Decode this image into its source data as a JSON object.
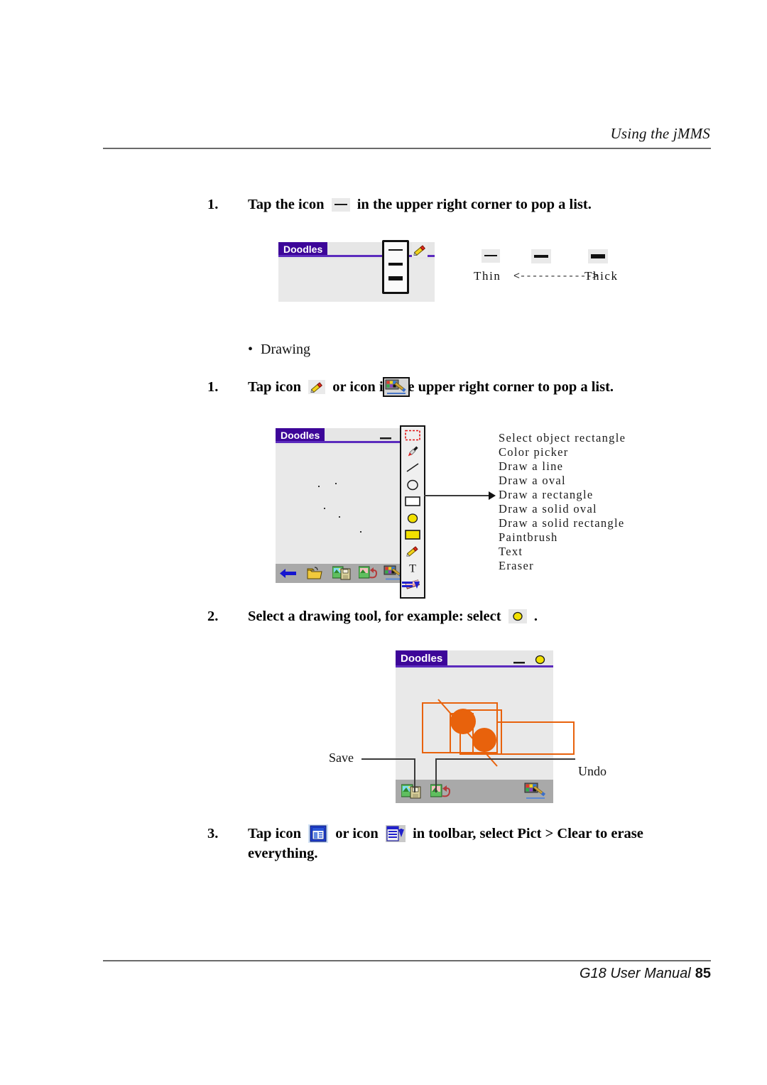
{
  "header": {
    "title": "Using the jMMS"
  },
  "footer": {
    "manual": "G18 User Manual",
    "page": "85"
  },
  "steps": {
    "s1": {
      "num": "1.",
      "before": "Tap the icon",
      "after": "in the upper right corner to pop a list."
    },
    "bullet": {
      "dot": "•",
      "label": "Drawing"
    },
    "s2": {
      "num": "1.",
      "part1": "Tap icon",
      "part2": "or icon",
      "part3": "in the upper right corner to pop a list."
    },
    "s3": {
      "num": "2.",
      "text": "Select a drawing tool, for example: select",
      "tail": "."
    },
    "s4": {
      "num": "3.",
      "part1": "Tap icon",
      "part2": "or icon",
      "part3": "in toolbar, select Pict > Clear to erase",
      "part4": "everything."
    }
  },
  "legend": {
    "thin": "Thin",
    "arrow": "<------------>",
    "thick": "Thick"
  },
  "window1": {
    "title": "Doodles"
  },
  "window2": {
    "title": "Doodles",
    "tools": [
      "Select object rectangle",
      "Color picker",
      "Draw a line",
      "Draw a oval",
      "Draw a rectangle",
      "Draw a solid oval",
      "Draw a solid rectangle",
      "Paintbrush",
      "Text",
      "Eraser"
    ]
  },
  "window3": {
    "title": "Doodles",
    "save_label": "Save",
    "undo_label": "Undo"
  },
  "colors": {
    "titlebar": "#3d0699",
    "titlerule": "#5b2bbd",
    "drawing": "#e8620c",
    "toolbar": "#a9a9a9",
    "canvas": "#e9e9e9",
    "rule": "#6a6a6a"
  }
}
